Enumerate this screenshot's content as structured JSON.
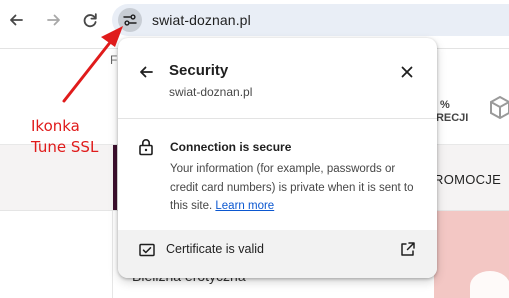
{
  "toolbar": {
    "back_icon": "arrow-left-icon",
    "forward_icon": "arrow-right-icon",
    "reload_icon": "reload-icon",
    "site_info_icon": "tune-icon",
    "url": "swiat-doznan.pl"
  },
  "background_page": {
    "header_letter": "F",
    "badge_line1": "%",
    "badge_line2": "KRECJI",
    "promo_text": "ROMOCJE",
    "menu_item": "Bielizna erotyczna"
  },
  "annotation": {
    "label_line1": "Ikonka",
    "label_line2": "Tune SSL",
    "color": "#e01b1b"
  },
  "security_popup": {
    "title": "Security",
    "site": "swiat-doznan.pl",
    "connection_title": "Connection is secure",
    "connection_body": "Your information (for example, passwords or credit card numbers) is private when it is sent to this site.",
    "learn_more": "Learn more",
    "certificate_label": "Certificate is valid",
    "icons": {
      "back": "arrow-left-icon",
      "close": "close-icon",
      "lock": "lock-icon",
      "certificate": "certificate-icon",
      "external": "external-link-icon"
    }
  },
  "colors": {
    "link": "#0b57d0",
    "omnibox_bg": "#e9eef6",
    "accent_purple": "#3d0f2e",
    "accent_pink": "#f3c7c4"
  }
}
